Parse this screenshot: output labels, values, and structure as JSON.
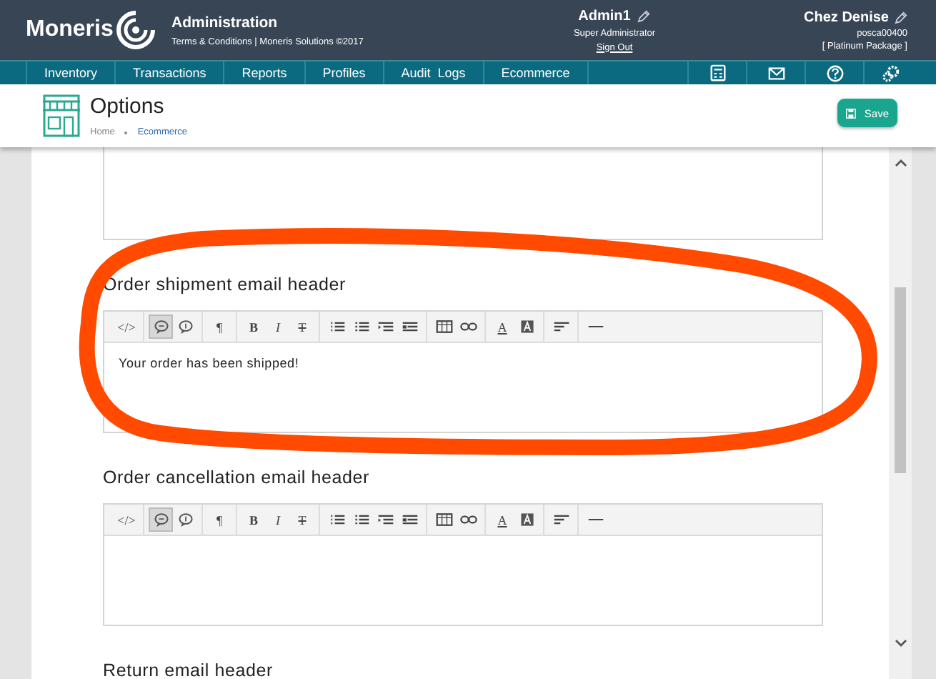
{
  "header": {
    "logo": "Moneris",
    "title": "Administration",
    "subtitle": "Terms & Conditions | Moneris Solutions ©2017",
    "user": {
      "name": "Admin1",
      "role": "Super Administrator",
      "link": "Sign Out"
    },
    "store": {
      "name": "Chez Denise",
      "id": "posca00400",
      "package": "[ Platinum Package ]"
    }
  },
  "nav": {
    "items": [
      "Inventory",
      "Transactions",
      "Reports",
      "Profiles",
      "Audit  Logs",
      "Ecommerce"
    ],
    "icons": [
      {
        "kind": "calculator"
      },
      {
        "kind": "mail"
      },
      {
        "kind": "help"
      },
      {
        "kind": "gears"
      }
    ]
  },
  "page": {
    "title": "Options",
    "breadcrumb": [
      "Home",
      "Ecommerce"
    ],
    "save": "Save"
  },
  "editors": [
    {
      "kind": "cut"
    },
    {
      "kind": "full",
      "label": "Order shipment email header",
      "value": "Your order has been shipped!",
      "toolbar": [
        [
          {
            "kind": "glyph",
            "label": "</>",
            "selected": false
          }
        ],
        [
          {
            "kind": "bubble",
            "selected": true
          },
          {
            "kind": "bubble2",
            "selected": false
          }
        ],
        [
          {
            "kind": "glyph",
            "label": "¶",
            "selected": false
          }
        ],
        [
          {
            "kind": "bold",
            "label": "B",
            "selected": false
          },
          {
            "kind": "italic",
            "label": "I",
            "selected": false
          },
          {
            "kind": "strike",
            "label": "T",
            "selected": false
          }
        ],
        [
          {
            "kind": "ul",
            "selected": false
          },
          {
            "kind": "ol",
            "selected": false
          },
          {
            "kind": "outdent",
            "selected": false
          },
          {
            "kind": "indent",
            "selected": false
          }
        ],
        [
          {
            "kind": "table",
            "selected": false
          },
          {
            "kind": "link",
            "selected": false
          }
        ],
        [
          {
            "kind": "underline",
            "label": "A",
            "selected": false
          },
          {
            "kind": "highlight",
            "selected": false
          }
        ],
        [
          {
            "kind": "align",
            "selected": false
          }
        ],
        [
          {
            "kind": "hr",
            "selected": false
          }
        ]
      ]
    },
    {
      "kind": "full",
      "label": "Order cancellation email header",
      "toolbar": [
        [
          {
            "kind": "glyph",
            "label": "</>",
            "selected": false
          }
        ],
        [
          {
            "kind": "bubble",
            "selected": true
          },
          {
            "kind": "bubble2",
            "selected": false
          }
        ],
        [
          {
            "kind": "glyph",
            "label": "¶",
            "selected": false
          }
        ],
        [
          {
            "kind": "bold",
            "label": "B",
            "selected": false
          },
          {
            "kind": "italic",
            "label": "I",
            "selected": false
          },
          {
            "kind": "strike",
            "label": "T",
            "selected": false
          }
        ],
        [
          {
            "kind": "ul",
            "selected": false
          },
          {
            "kind": "ol",
            "selected": false
          },
          {
            "kind": "outdent",
            "selected": false
          },
          {
            "kind": "indent",
            "selected": false
          }
        ],
        [
          {
            "kind": "table",
            "selected": false
          },
          {
            "kind": "link",
            "selected": false
          }
        ],
        [
          {
            "kind": "underline",
            "label": "A",
            "selected": false
          },
          {
            "kind": "highlight",
            "selected": false
          }
        ],
        [
          {
            "kind": "align",
            "selected": false
          }
        ],
        [
          {
            "kind": "hr",
            "selected": false
          }
        ]
      ]
    },
    {
      "kind": "label_only",
      "label": "Return email header"
    }
  ]
}
